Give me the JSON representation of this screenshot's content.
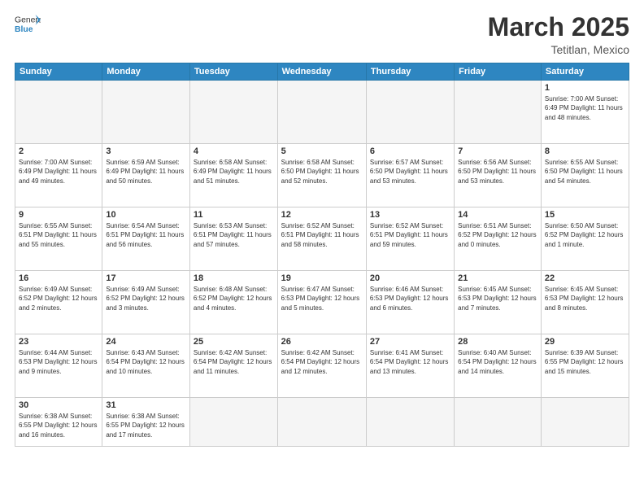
{
  "logo": {
    "text_general": "General",
    "text_blue": "Blue"
  },
  "title": "March 2025",
  "subtitle": "Tetitlan, Mexico",
  "weekdays": [
    "Sunday",
    "Monday",
    "Tuesday",
    "Wednesday",
    "Thursday",
    "Friday",
    "Saturday"
  ],
  "weeks": [
    [
      {
        "day": "",
        "info": ""
      },
      {
        "day": "",
        "info": ""
      },
      {
        "day": "",
        "info": ""
      },
      {
        "day": "",
        "info": ""
      },
      {
        "day": "",
        "info": ""
      },
      {
        "day": "",
        "info": ""
      },
      {
        "day": "1",
        "info": "Sunrise: 7:00 AM\nSunset: 6:49 PM\nDaylight: 11 hours\nand 48 minutes."
      }
    ],
    [
      {
        "day": "2",
        "info": "Sunrise: 7:00 AM\nSunset: 6:49 PM\nDaylight: 11 hours\nand 49 minutes."
      },
      {
        "day": "3",
        "info": "Sunrise: 6:59 AM\nSunset: 6:49 PM\nDaylight: 11 hours\nand 50 minutes."
      },
      {
        "day": "4",
        "info": "Sunrise: 6:58 AM\nSunset: 6:49 PM\nDaylight: 11 hours\nand 51 minutes."
      },
      {
        "day": "5",
        "info": "Sunrise: 6:58 AM\nSunset: 6:50 PM\nDaylight: 11 hours\nand 52 minutes."
      },
      {
        "day": "6",
        "info": "Sunrise: 6:57 AM\nSunset: 6:50 PM\nDaylight: 11 hours\nand 53 minutes."
      },
      {
        "day": "7",
        "info": "Sunrise: 6:56 AM\nSunset: 6:50 PM\nDaylight: 11 hours\nand 53 minutes."
      },
      {
        "day": "8",
        "info": "Sunrise: 6:55 AM\nSunset: 6:50 PM\nDaylight: 11 hours\nand 54 minutes."
      }
    ],
    [
      {
        "day": "9",
        "info": "Sunrise: 6:55 AM\nSunset: 6:51 PM\nDaylight: 11 hours\nand 55 minutes."
      },
      {
        "day": "10",
        "info": "Sunrise: 6:54 AM\nSunset: 6:51 PM\nDaylight: 11 hours\nand 56 minutes."
      },
      {
        "day": "11",
        "info": "Sunrise: 6:53 AM\nSunset: 6:51 PM\nDaylight: 11 hours\nand 57 minutes."
      },
      {
        "day": "12",
        "info": "Sunrise: 6:52 AM\nSunset: 6:51 PM\nDaylight: 11 hours\nand 58 minutes."
      },
      {
        "day": "13",
        "info": "Sunrise: 6:52 AM\nSunset: 6:51 PM\nDaylight: 11 hours\nand 59 minutes."
      },
      {
        "day": "14",
        "info": "Sunrise: 6:51 AM\nSunset: 6:52 PM\nDaylight: 12 hours\nand 0 minutes."
      },
      {
        "day": "15",
        "info": "Sunrise: 6:50 AM\nSunset: 6:52 PM\nDaylight: 12 hours\nand 1 minute."
      }
    ],
    [
      {
        "day": "16",
        "info": "Sunrise: 6:49 AM\nSunset: 6:52 PM\nDaylight: 12 hours\nand 2 minutes."
      },
      {
        "day": "17",
        "info": "Sunrise: 6:49 AM\nSunset: 6:52 PM\nDaylight: 12 hours\nand 3 minutes."
      },
      {
        "day": "18",
        "info": "Sunrise: 6:48 AM\nSunset: 6:52 PM\nDaylight: 12 hours\nand 4 minutes."
      },
      {
        "day": "19",
        "info": "Sunrise: 6:47 AM\nSunset: 6:53 PM\nDaylight: 12 hours\nand 5 minutes."
      },
      {
        "day": "20",
        "info": "Sunrise: 6:46 AM\nSunset: 6:53 PM\nDaylight: 12 hours\nand 6 minutes."
      },
      {
        "day": "21",
        "info": "Sunrise: 6:45 AM\nSunset: 6:53 PM\nDaylight: 12 hours\nand 7 minutes."
      },
      {
        "day": "22",
        "info": "Sunrise: 6:45 AM\nSunset: 6:53 PM\nDaylight: 12 hours\nand 8 minutes."
      }
    ],
    [
      {
        "day": "23",
        "info": "Sunrise: 6:44 AM\nSunset: 6:53 PM\nDaylight: 12 hours\nand 9 minutes."
      },
      {
        "day": "24",
        "info": "Sunrise: 6:43 AM\nSunset: 6:54 PM\nDaylight: 12 hours\nand 10 minutes."
      },
      {
        "day": "25",
        "info": "Sunrise: 6:42 AM\nSunset: 6:54 PM\nDaylight: 12 hours\nand 11 minutes."
      },
      {
        "day": "26",
        "info": "Sunrise: 6:42 AM\nSunset: 6:54 PM\nDaylight: 12 hours\nand 12 minutes."
      },
      {
        "day": "27",
        "info": "Sunrise: 6:41 AM\nSunset: 6:54 PM\nDaylight: 12 hours\nand 13 minutes."
      },
      {
        "day": "28",
        "info": "Sunrise: 6:40 AM\nSunset: 6:54 PM\nDaylight: 12 hours\nand 14 minutes."
      },
      {
        "day": "29",
        "info": "Sunrise: 6:39 AM\nSunset: 6:55 PM\nDaylight: 12 hours\nand 15 minutes."
      }
    ],
    [
      {
        "day": "30",
        "info": "Sunrise: 6:38 AM\nSunset: 6:55 PM\nDaylight: 12 hours\nand 16 minutes."
      },
      {
        "day": "31",
        "info": "Sunrise: 6:38 AM\nSunset: 6:55 PM\nDaylight: 12 hours\nand 17 minutes."
      },
      {
        "day": "",
        "info": ""
      },
      {
        "day": "",
        "info": ""
      },
      {
        "day": "",
        "info": ""
      },
      {
        "day": "",
        "info": ""
      },
      {
        "day": "",
        "info": ""
      }
    ]
  ]
}
